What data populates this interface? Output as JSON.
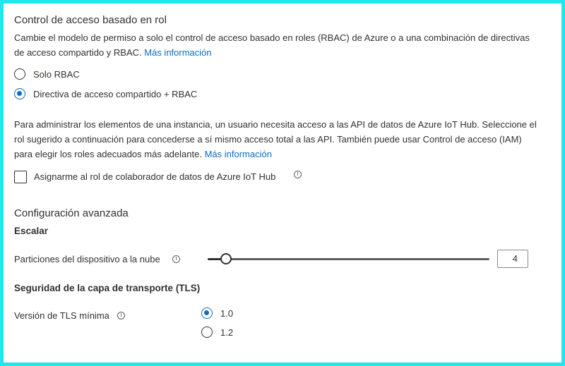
{
  "rbac": {
    "title": "Control de acceso basado en rol",
    "description": "Cambie el modelo de permiso a solo el control de acceso basado en roles (RBAC) de Azure o a una combinación de directivas de acceso compartido y RBAC.",
    "learn_more": "Más información",
    "options": [
      {
        "label": "Solo RBAC",
        "selected": false
      },
      {
        "label": "Directiva de acceso compartido + RBAC",
        "selected": true
      }
    ]
  },
  "admin_info": {
    "text": "Para administrar los elementos de una instancia, un usuario necesita acceso a las API de datos de Azure IoT Hub. Seleccione el rol sugerido a continuación para concederse a sí mismo acceso total a las API. También puede usar Control de acceso (IAM) para elegir los roles adecuados más adelante.",
    "learn_more": "Más información"
  },
  "assign_role": {
    "label": "Asignarme al rol de colaborador de datos de Azure IoT Hub",
    "checked": false,
    "icon": "info-icon"
  },
  "advanced": {
    "title": "Configuración avanzada",
    "scale_heading": "Escalar",
    "partitions": {
      "label": "Particiones del dispositivo a la nube",
      "value": "4",
      "level_fraction": 0.065,
      "icon": "info-icon"
    },
    "tls_heading": "Seguridad de la capa de transporte (TLS)",
    "tls_version": {
      "label": "Versión de TLS mínima",
      "icon": "info-icon",
      "options": [
        {
          "label": "1.0",
          "selected": true
        },
        {
          "label": "1.2",
          "selected": false
        }
      ]
    }
  },
  "colors": {
    "accent": "#0f6cbd",
    "frame": "#22e6ee",
    "text": "#323130"
  }
}
